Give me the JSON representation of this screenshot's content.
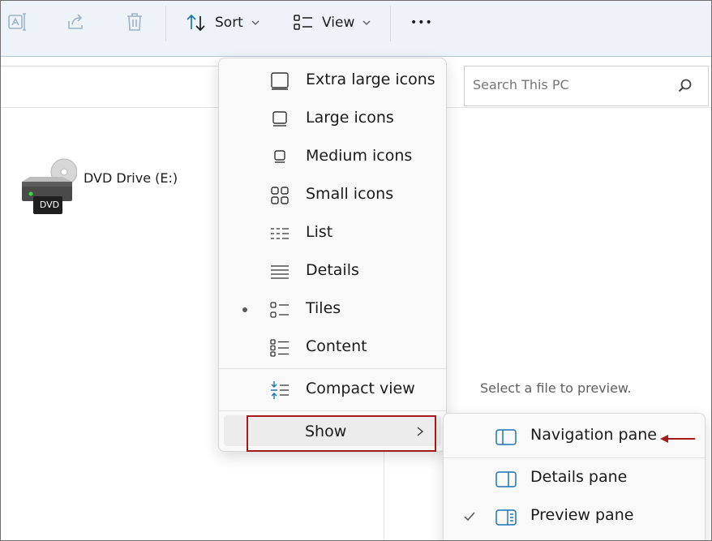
{
  "toolbar": {
    "sort_label": "Sort",
    "view_label": "View",
    "more_label": "•••"
  },
  "search": {
    "placeholder": "Search This PC"
  },
  "drive": {
    "label": "DVD Drive (E:)",
    "badge": "DVD"
  },
  "preview_message": "Select a file to preview.",
  "view_menu": {
    "items": [
      {
        "label": "Extra large icons",
        "icon": "extra-large-icons-icon"
      },
      {
        "label": "Large icons",
        "icon": "large-icons-icon"
      },
      {
        "label": "Medium icons",
        "icon": "medium-icons-icon"
      },
      {
        "label": "Small icons",
        "icon": "small-icons-icon"
      },
      {
        "label": "List",
        "icon": "list-icon"
      },
      {
        "label": "Details",
        "icon": "details-icon"
      },
      {
        "label": "Tiles",
        "icon": "tiles-icon",
        "selected": true
      },
      {
        "label": "Content",
        "icon": "content-icon"
      }
    ],
    "compact_label": "Compact view",
    "show_label": "Show"
  },
  "show_menu": {
    "items": [
      {
        "label": "Navigation pane",
        "icon": "navigation-pane-icon"
      },
      {
        "label": "Details pane",
        "icon": "details-pane-icon"
      },
      {
        "label": "Preview pane",
        "icon": "preview-pane-icon",
        "checked": true
      }
    ]
  },
  "colors": {
    "toolbar_bg": "#eef3f9",
    "menu_bg": "#f9f9f9",
    "highlight_border": "#a31b1b",
    "accent_icon": "#1a73b5"
  }
}
